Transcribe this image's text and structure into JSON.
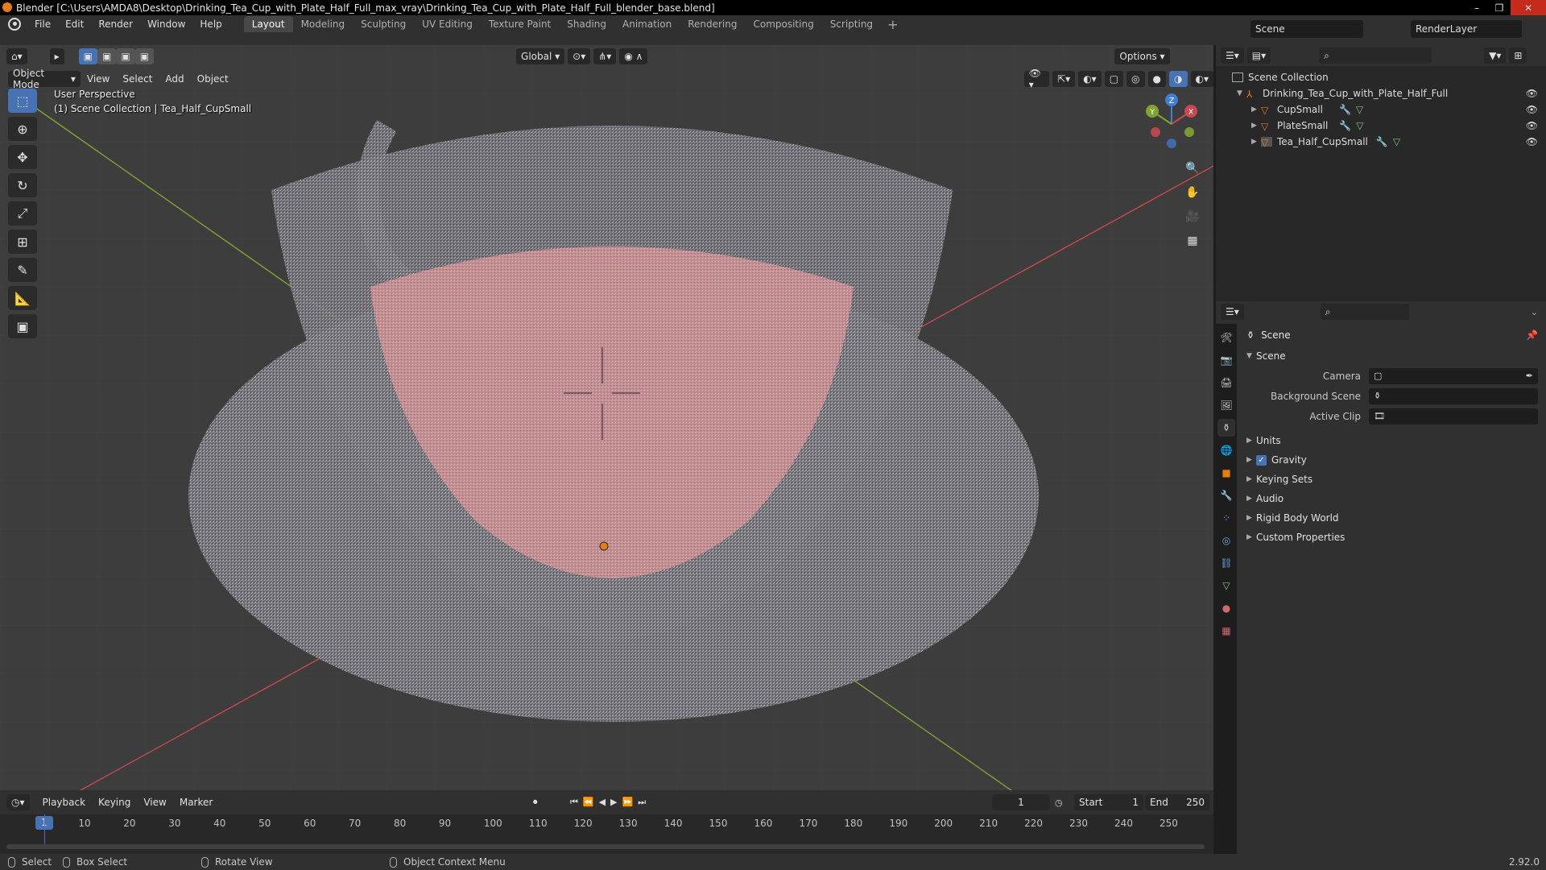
{
  "window": {
    "title": "Blender [C:\\Users\\AMDA8\\Desktop\\Drinking_Tea_Cup_with_Plate_Half_Full_max_vray\\Drinking_Tea_Cup_with_Plate_Half_Full_blender_base.blend]",
    "min": "–",
    "max": "❐",
    "close": "✕"
  },
  "menus": [
    "File",
    "Edit",
    "Render",
    "Window",
    "Help"
  ],
  "workspaces": [
    "Layout",
    "Modeling",
    "Sculpting",
    "UV Editing",
    "Texture Paint",
    "Shading",
    "Animation",
    "Rendering",
    "Compositing",
    "Scripting"
  ],
  "active_workspace": "Layout",
  "scene_name": "Scene",
  "render_layer": "RenderLayer",
  "viewport": {
    "mode": "Object Mode",
    "menus": [
      "View",
      "Select",
      "Add",
      "Object"
    ],
    "transform_orientation": "Global",
    "options": "Options",
    "perspective": "User Perspective",
    "collection_info": "(1) Scene Collection | Tea_Half_CupSmall"
  },
  "gizmo": {
    "x": "X",
    "y": "Y",
    "z": "Z"
  },
  "outliner": {
    "root": "Scene Collection",
    "collection": "Drinking_Tea_Cup_with_Plate_Half_Full",
    "objects": [
      "CupSmall",
      "PlateSmall",
      "Tea_Half_CupSmall"
    ]
  },
  "properties": {
    "title": "Scene",
    "section": "Scene",
    "fields": [
      {
        "label": "Camera",
        "value": ""
      },
      {
        "label": "Background Scene",
        "value": ""
      },
      {
        "label": "Active Clip",
        "value": ""
      }
    ],
    "subsections": [
      "Units",
      "Gravity",
      "Keying Sets",
      "Audio",
      "Rigid Body World",
      "Custom Properties"
    ],
    "gravity_checked": true
  },
  "timeline": {
    "menus": [
      "Playback",
      "Keying",
      "View",
      "Marker"
    ],
    "current_frame": "1",
    "start_label": "Start",
    "start": "1",
    "end_label": "End",
    "end": "250",
    "ticks": [
      "10",
      "20",
      "30",
      "40",
      "50",
      "60",
      "70",
      "80",
      "90",
      "100",
      "110",
      "120",
      "130",
      "140",
      "150",
      "160",
      "170",
      "180",
      "190",
      "200",
      "210",
      "220",
      "230",
      "240",
      "250"
    ],
    "cursor": "1"
  },
  "statusbar": {
    "select": "Select",
    "box_select": "Box Select",
    "rotate": "Rotate View",
    "context_menu": "Object Context Menu",
    "version": "2.92.0"
  },
  "colors": {
    "accent": "#4772b3",
    "x_axis": "#c8484e",
    "y_axis": "#7fa531",
    "z_axis": "#3f7fd4",
    "object_orange": "#e87d0d"
  }
}
